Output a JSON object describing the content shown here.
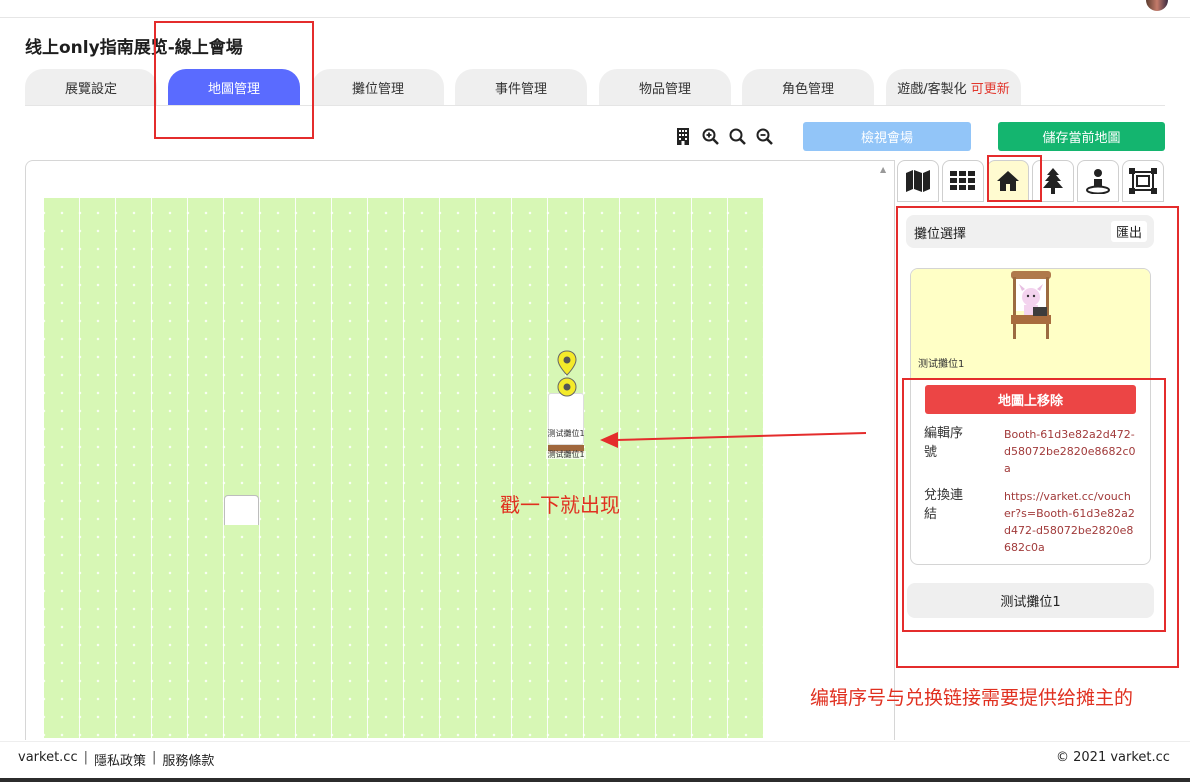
{
  "header": {
    "title": "线上only指南展览-線上會場"
  },
  "tabs": [
    {
      "label": "展覽設定"
    },
    {
      "label": "地圖管理",
      "active": true
    },
    {
      "label": "攤位管理"
    },
    {
      "label": "事件管理"
    },
    {
      "label": "物品管理"
    },
    {
      "label": "角色管理"
    },
    {
      "label": "遊戲/客製化",
      "accent": "可更新"
    }
  ],
  "toolbar": {
    "icons": [
      "building-icon",
      "zoom-in-icon",
      "search-icon",
      "zoom-out-icon"
    ],
    "view_label": "檢視會場",
    "save_label": "儲存當前地圖"
  },
  "side_tools": [
    "map-icon",
    "grid-icon",
    "home-icon",
    "tree-icon",
    "person-pin-icon",
    "frame-icon"
  ],
  "side_panel": {
    "select_label": "攤位選擇",
    "export_label": "匯出",
    "card_name": "测试攤位1",
    "remove_label": "地圖上移除",
    "serial_label": "編輯序號",
    "serial_value": "Booth-61d3e82a2d472-d58072be2820e8682c0a",
    "voucher_label": "兌換連結",
    "voucher_value": "https://varket.cc/voucher?s=Booth-61d3e82a2d472-d58072be2820e8682c0a",
    "bottom_label": "测试攤位1"
  },
  "map": {
    "booth_label": "测试攤位1",
    "booth_label2": "测试攤位1"
  },
  "annotations": {
    "map_note": "戳一下就出现",
    "side_note": "编辑序号与兑换链接需要提供给摊主的"
  },
  "footer": {
    "site": "varket.cc",
    "privacy": "隱私政策",
    "terms": "服務條款",
    "copyright": "© 2021 varket.cc"
  },
  "colors": {
    "tab_active": "#5a6bff",
    "view_button": "#92c5f8",
    "save_button": "#14b56f",
    "remove_button": "#ec4545",
    "grass": "#d7f7b5",
    "annotation_red": "#e42c2c"
  }
}
